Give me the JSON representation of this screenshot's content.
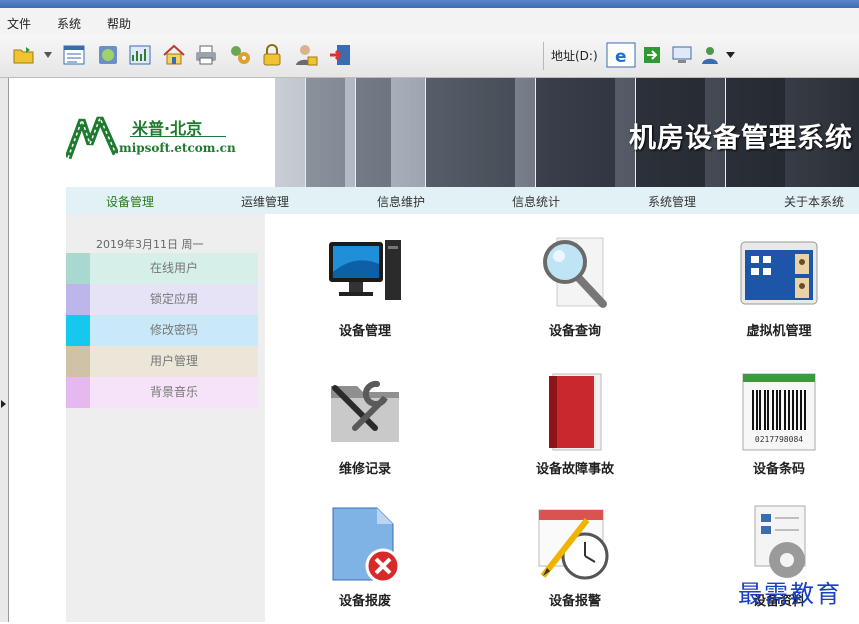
{
  "menu": {
    "items": [
      "文件",
      "系统",
      "帮助"
    ]
  },
  "toolbar": {
    "address_label": "地址(D:)"
  },
  "logo": {
    "name": "米普·北京",
    "url": "mipsoft.etcom.cn"
  },
  "banner": {
    "title": "机房设备管理系统"
  },
  "nav": {
    "items": [
      "设备管理",
      "运维管理",
      "信息维护",
      "信息统计",
      "系统管理",
      "关于本系统"
    ],
    "active_index": 0
  },
  "sidebar": {
    "date": "2019年3月11日 周一",
    "items": [
      {
        "label": "在线用户",
        "swatch": "#a8d8cf",
        "bg": "#d6efe9"
      },
      {
        "label": "锁定应用",
        "swatch": "#bcb6ea",
        "bg": "#e6e3f7"
      },
      {
        "label": "修改密码",
        "swatch": "#15c8ee",
        "bg": "#c9e8f8"
      },
      {
        "label": "用户管理",
        "swatch": "#cfc2a6",
        "bg": "#ece6d8"
      },
      {
        "label": "背景音乐",
        "swatch": "#e6b8f0",
        "bg": "#f6e3fa"
      }
    ]
  },
  "tiles": [
    {
      "label": "设备管理",
      "icon": "computer-monitor-icon"
    },
    {
      "label": "设备查询",
      "icon": "magnifier-icon"
    },
    {
      "label": "虚拟机管理",
      "icon": "virtual-machine-icon"
    },
    {
      "label": "维修记录",
      "icon": "tools-folder-icon"
    },
    {
      "label": "设备故障事故",
      "icon": "red-notebook-icon"
    },
    {
      "label": "设备条码",
      "icon": "barcode-icon"
    },
    {
      "label": "设备报废",
      "icon": "delete-document-icon"
    },
    {
      "label": "设备报警",
      "icon": "clock-pencil-icon"
    },
    {
      "label": "设备资料",
      "icon": "gear-document-icon"
    }
  ],
  "barcode_number": "0217798084",
  "watermark": "最需教育"
}
